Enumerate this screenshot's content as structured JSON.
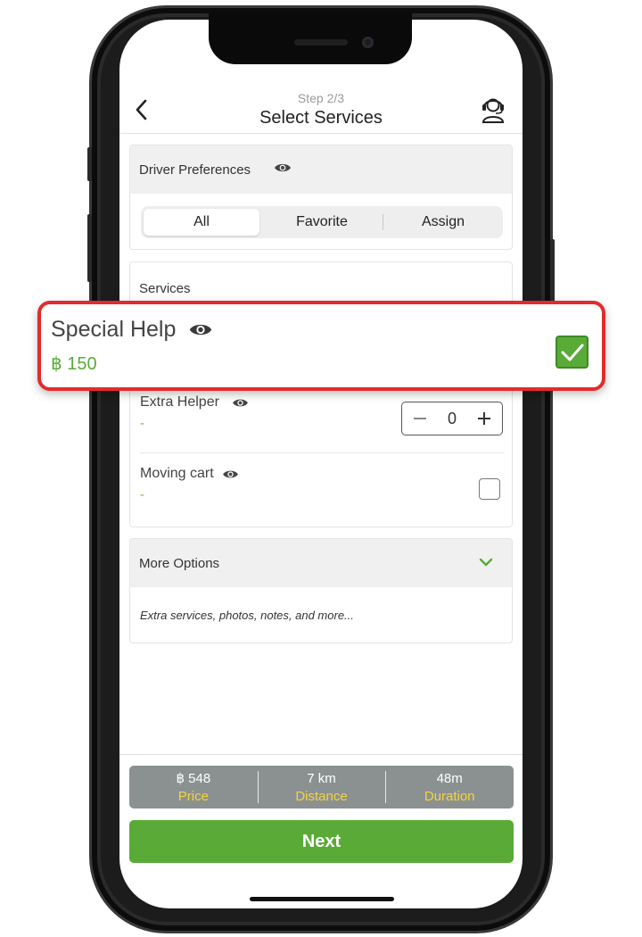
{
  "header": {
    "step": "Step 2/3",
    "title": "Select Services",
    "back_icon": "chevron-left-icon",
    "support_icon": "headset-support-icon"
  },
  "driver_preferences": {
    "title": "Driver Preferences",
    "tabs": [
      {
        "label": "All",
        "active": true
      },
      {
        "label": "Favorite",
        "active": false
      },
      {
        "label": "Assign",
        "active": false
      }
    ]
  },
  "services": {
    "title": "Services",
    "items": [
      {
        "name": "Extra Helper",
        "price": "-",
        "control": "stepper",
        "value": "0"
      },
      {
        "name": "Moving cart",
        "price": "-",
        "control": "checkbox",
        "checked": false
      }
    ]
  },
  "highlight": {
    "name": "Special Help",
    "price": "฿ 150",
    "checked": true,
    "border_color": "#e32b2b"
  },
  "more_options": {
    "title": "More Options",
    "note": "Extra services, photos, notes, and more..."
  },
  "summary": [
    {
      "value": "฿ 548",
      "label": "Price"
    },
    {
      "value": "7 km",
      "label": "Distance"
    },
    {
      "value": "48m",
      "label": "Duration"
    }
  ],
  "next_label": "Next",
  "colors": {
    "accent_green": "#5aaa38",
    "summary_bg": "#8b9191",
    "summary_label": "#f2d53c"
  }
}
